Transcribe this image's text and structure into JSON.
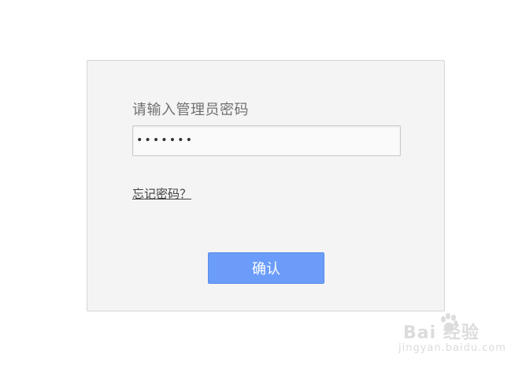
{
  "login": {
    "prompt": "请输入管理员密码",
    "password_value": "•••••••",
    "forgot_label": "忘记密码？",
    "confirm_label": "确认"
  },
  "watermark": {
    "logo_text": "Bai 经验",
    "sub_text": "jingyan.baidu.com"
  },
  "colors": {
    "accent": "#6b9cf9",
    "panel_bg": "#f4f4f4",
    "panel_border": "#d6d6d6"
  }
}
